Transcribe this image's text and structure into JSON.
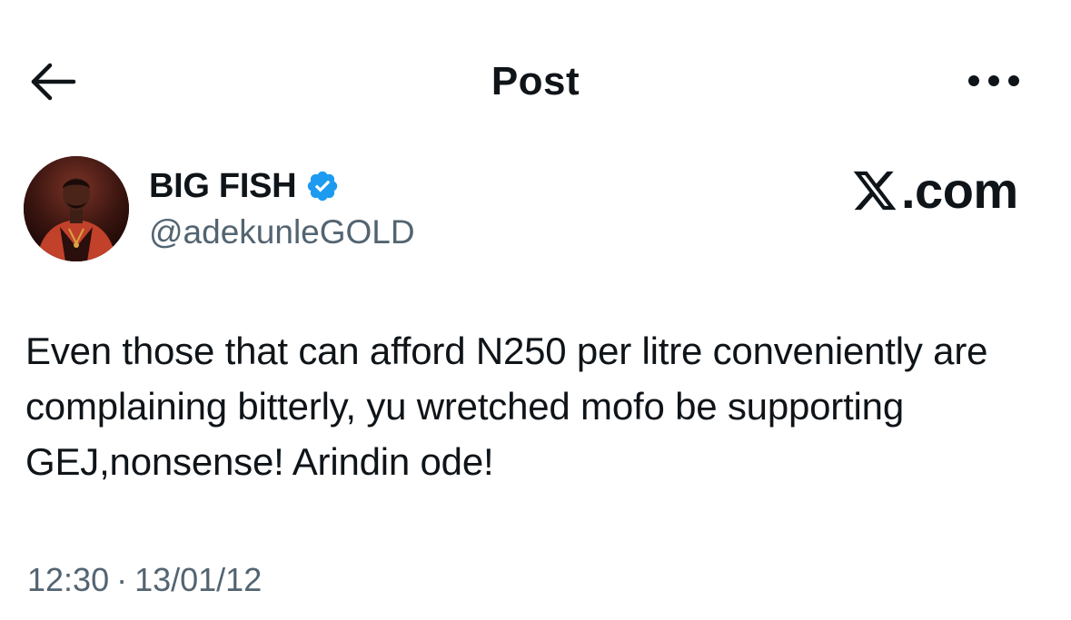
{
  "header": {
    "title": "Post",
    "back_icon": "arrow-left-icon",
    "more_icon": "more-horizontal-icon"
  },
  "author": {
    "display_name": "BIG FISH",
    "handle": "@adekunleGOLD",
    "verified": true,
    "verified_color": "#1d9bf0"
  },
  "watermark": {
    "text": ".com"
  },
  "post": {
    "text": "Even those that can afford N250 per litre conveniently are complaining bitterly, yu wretched mofo be supporting GEJ,nonsense! Arindin ode!",
    "time": "12:30",
    "separator": "·",
    "date": "13/01/12"
  },
  "colors": {
    "text_primary": "#0f1419",
    "text_secondary": "#536471",
    "accent": "#1d9bf0",
    "background": "#ffffff"
  }
}
